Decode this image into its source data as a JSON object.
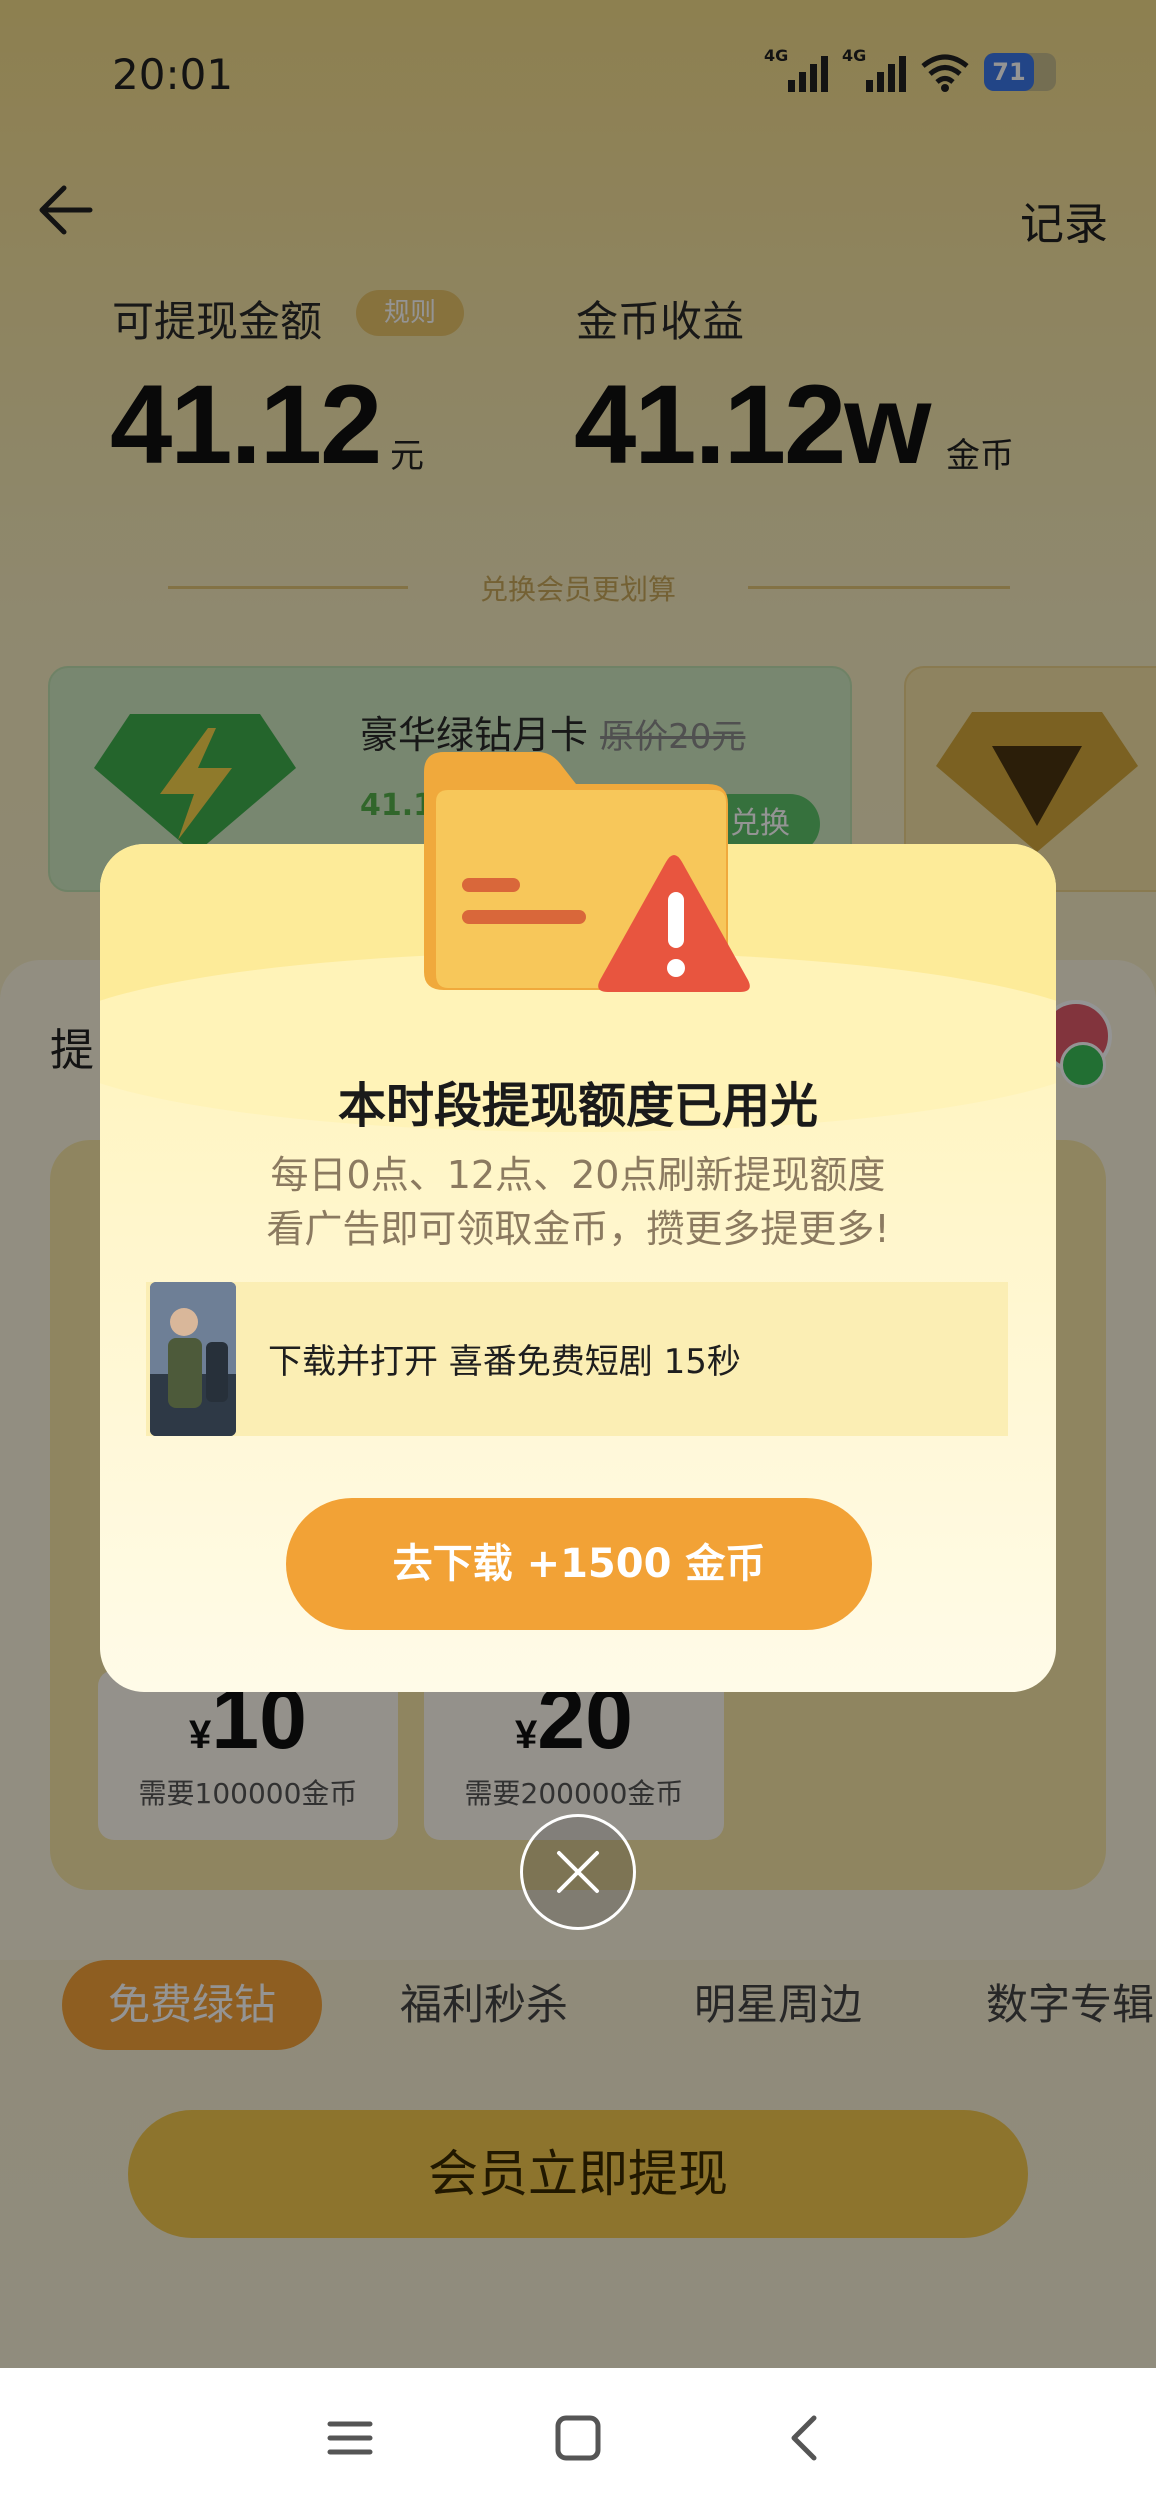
{
  "status_bar": {
    "time": "20:01",
    "signal_1_tag": "4G",
    "signal_2_tag": "4G",
    "battery_level": "71"
  },
  "header": {
    "back_icon": "arrow-left-icon",
    "record_label": "记录"
  },
  "balance": {
    "withdrawable_label": "可提现金额",
    "rule_badge": "规则",
    "withdrawable_amount": "41.12",
    "withdrawable_unit": "元",
    "coin_label": "金币收益",
    "coin_amount": "41.12w",
    "coin_unit": "金币"
  },
  "exchange": {
    "divider_text": "兑换会员更划算",
    "card_title": "豪华绿钻月卡",
    "card_original_price": "原价20元",
    "card_price": "41.12",
    "card_button": "兑换"
  },
  "withdraw_panel": {
    "title": "提",
    "amounts": [
      {
        "currency": "¥",
        "value": "10",
        "requirement": "需要100000金币"
      },
      {
        "currency": "¥",
        "value": "20",
        "requirement": "需要200000金币"
      }
    ]
  },
  "tabs": [
    {
      "label": "免费绿钻",
      "active": true
    },
    {
      "label": "福利秒杀",
      "active": false
    },
    {
      "label": "明星周边",
      "active": false
    },
    {
      "label": "数字专辑",
      "active": false
    }
  ],
  "main_cta": "会员立即提现",
  "dialog": {
    "title": "本时段提现额度已用光",
    "line1": "每日0点、12点、20点刷新提现额度",
    "line2": "看广告即可领取金币，攒更多提更多!",
    "task_text": "下载并打开 喜番免费短剧 15秒",
    "button_label": "去下载 +1500 金币",
    "icon": "folder-warning-icon"
  },
  "colors": {
    "accent_orange": "#f2a236",
    "dialog_bg": "#fff6cc",
    "green": "#5ec36a",
    "warning_red": "#e8553f"
  }
}
